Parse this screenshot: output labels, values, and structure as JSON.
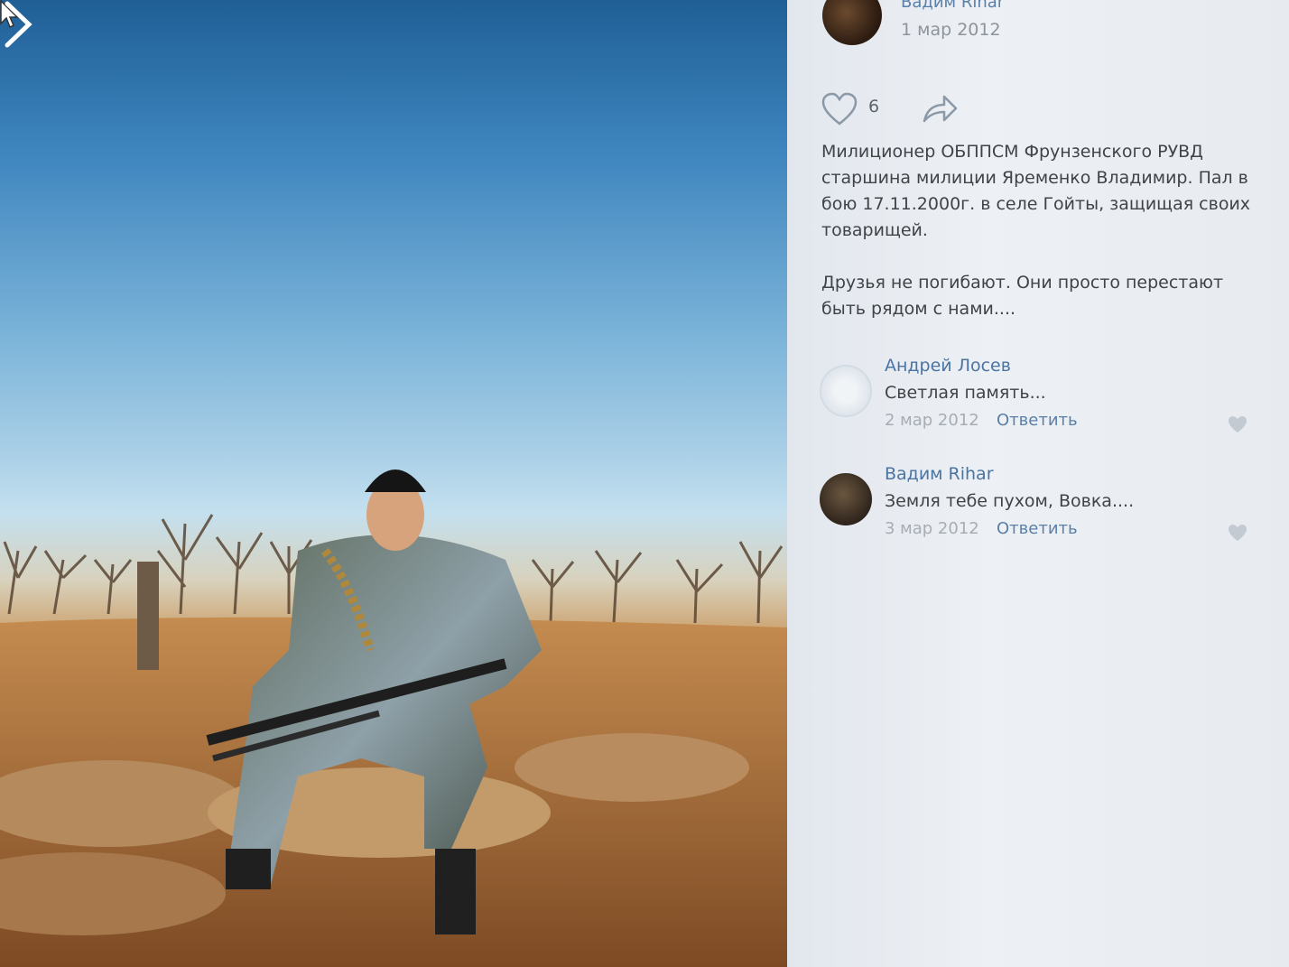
{
  "photo": {
    "alt_icons": {
      "next": "chevron-right-icon",
      "cursor": "mouse-pointer-icon"
    }
  },
  "post": {
    "author_name": "Вадим Rihar",
    "date": "1 мар 2012",
    "like_count": "6",
    "text": "Милиционер ОБППСМ Фрунзенского РУВД старшина милиции Яременко Владимир. Пал в бою 17.11.2000г. в селе Гойты, защищая своих товарищей.\n\nДрузья не погибают. Они просто перестают быть рядом с нами....",
    "icons": {
      "like": "heart-icon",
      "share": "share-arrow-icon"
    }
  },
  "comments": [
    {
      "name": "Андрей Лосев",
      "text": "Светлая память...",
      "date": "2 мар 2012",
      "reply": "Ответить"
    },
    {
      "name": "Вадим Rihar",
      "text": "Земля тебе пухом, Вовка....",
      "date": "3 мар 2012",
      "reply": "Ответить"
    }
  ],
  "colors": {
    "link": "#4a74a2",
    "muted": "#a7adb4",
    "panel_bg": "#edf0f4"
  }
}
